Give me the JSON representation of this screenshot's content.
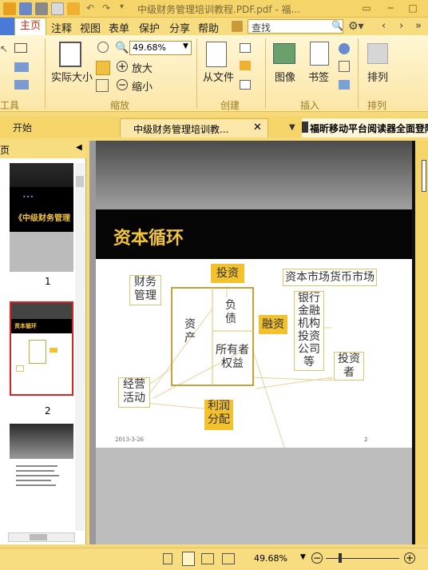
{
  "titlebar": {
    "title": "中级财务管理培训教程.PDF.pdf - 福..."
  },
  "menu": {
    "items": [
      "主页",
      "注释",
      "视图",
      "表单",
      "保护",
      "分享",
      "帮助"
    ],
    "search_placeholder": "查找"
  },
  "ribbon": {
    "actual_size": "实际大小",
    "zoom_value": "49.68%",
    "zoom_in": "放大",
    "zoom_out": "缩小",
    "from_file": "从文件",
    "image": "图像",
    "bookmark": "书签",
    "arrange": "排列",
    "groups": {
      "tools": "工具",
      "zoom": "缩放",
      "create": "创建",
      "insert": "插入",
      "arrange": "排列"
    }
  },
  "tabs": {
    "start": "开始",
    "doc": "中级财务管理培训教...",
    "ad": "福昕移动平台阅读器全面登陆"
  },
  "sidebar": {
    "header": "页",
    "pages": [
      {
        "num": "1",
        "caption": "《中级财务管理"
      },
      {
        "num": "2",
        "caption": "资本循环"
      }
    ]
  },
  "page": {
    "title": "资本循环",
    "boxes": {
      "fin_mgmt": "财务\n管理",
      "invest": "投资",
      "market": "资本市场货币市场",
      "assets": "资\n产",
      "liabilities": "负\n债",
      "equity": "所有者\n权益",
      "financing": "融资",
      "banks": "银行\n金融\n机构\n投资\n公司\n等",
      "investor": "投资\n者",
      "operations": "经营\n活动",
      "profit": "利润\n分配"
    },
    "date": "2013-3-26",
    "page_no": "2"
  },
  "status": {
    "zoom": "49.68%"
  },
  "colors": {
    "accent": "#f5d46a",
    "title_gold": "#f2c43c",
    "box_gold": "#f3c12c"
  }
}
